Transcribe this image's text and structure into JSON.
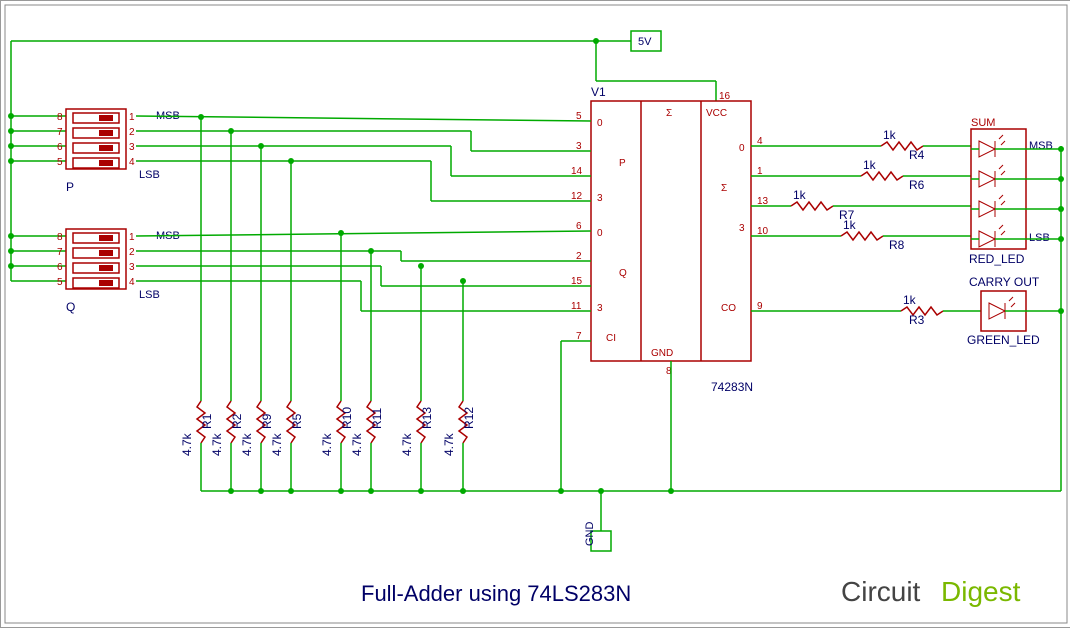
{
  "title": "Full-Adder using 74LS283N",
  "power_rail": "5V",
  "ground_label": "GND",
  "chip": {
    "ref": "V1",
    "part": "74283N",
    "pins": {
      "vcc": "16",
      "gnd": "8",
      "p0": "5",
      "p1": "3",
      "p2": "14",
      "p3": "12",
      "q0": "6",
      "q1": "2",
      "q2": "15",
      "q3": "11",
      "ci": "7",
      "s0": "4",
      "s1": "1",
      "s2": "13",
      "s3": "10",
      "co": "9"
    },
    "labels": {
      "sigma": "Σ",
      "vcc": "VCC",
      "p": "P",
      "q": "Q",
      "ci": "CI",
      "gnd": "GND",
      "co": "CO",
      "bit0": "0",
      "bit3": "3"
    }
  },
  "dip_p": {
    "ref": "P",
    "pins_left": [
      "8",
      "7",
      "6",
      "5"
    ],
    "pins_right": [
      "1",
      "2",
      "3",
      "4"
    ],
    "msb_label": "MSB",
    "lsb_label": "LSB"
  },
  "dip_q": {
    "ref": "Q",
    "pins_left": [
      "8",
      "7",
      "6",
      "5"
    ],
    "pins_right": [
      "1",
      "2",
      "3",
      "4"
    ],
    "msb_label": "MSB",
    "lsb_label": "LSB"
  },
  "pulldowns": {
    "value": "4.7k",
    "refs": [
      "R1",
      "R2",
      "R9",
      "R5",
      "R10",
      "R11",
      "R13",
      "R12"
    ]
  },
  "output_resistors": {
    "value": "1k",
    "sum": [
      "R4",
      "R6",
      "R7",
      "R8"
    ],
    "carry": "R3"
  },
  "leds": {
    "sum_label": "SUM",
    "red_label": "RED_LED",
    "carry_label": "CARRY OUT",
    "green_label": "GREEN_LED",
    "msb": "MSB",
    "lsb": "LSB"
  },
  "logo": {
    "main": "Circuit",
    "accent": "Digest"
  }
}
